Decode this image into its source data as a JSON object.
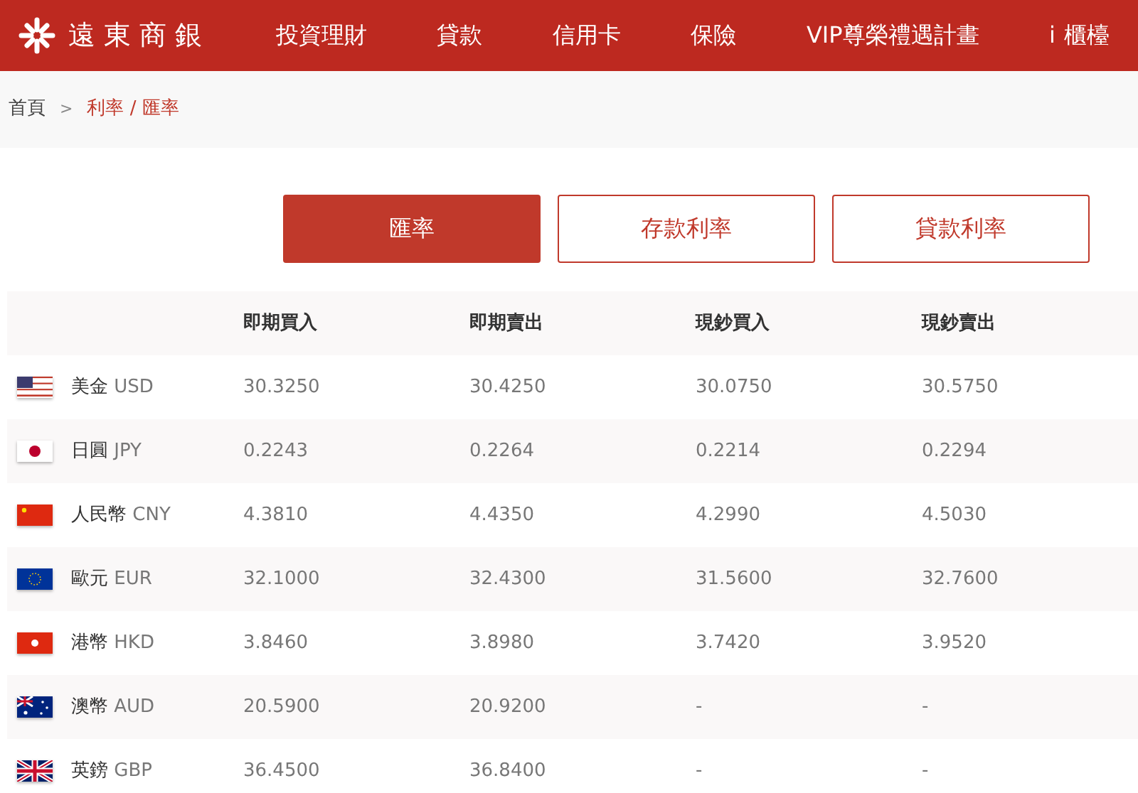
{
  "header": {
    "logo_text": "遠東商銀",
    "nav": [
      "投資理財",
      "貸款",
      "信用卡",
      "保險",
      "VIP尊榮禮遇計畫"
    ],
    "counter_icon": "i",
    "counter_label": "櫃檯"
  },
  "breadcrumb": {
    "home": "首頁",
    "separator": ">",
    "current": "利率 / 匯率"
  },
  "tabs": [
    {
      "label": "匯率",
      "selected": true
    },
    {
      "label": "存款利率",
      "selected": false
    },
    {
      "label": "貸款利率",
      "selected": false
    }
  ],
  "table": {
    "columns": [
      "即期買入",
      "即期賣出",
      "現鈔買入",
      "現鈔賣出"
    ],
    "rows": [
      {
        "kind": "us",
        "name": "美金",
        "code": "USD",
        "cells": [
          "30.3250",
          "30.4250",
          "30.0750",
          "30.5750"
        ]
      },
      {
        "kind": "jp",
        "name": "日圓",
        "code": "JPY",
        "cells": [
          "0.2243",
          "0.2264",
          "0.2214",
          "0.2294"
        ]
      },
      {
        "kind": "cn",
        "name": "人民幣",
        "code": "CNY",
        "cells": [
          "4.3810",
          "4.4350",
          "4.2990",
          "4.5030"
        ]
      },
      {
        "kind": "eu",
        "name": "歐元",
        "code": "EUR",
        "cells": [
          "32.1000",
          "32.4300",
          "31.5600",
          "32.7600"
        ]
      },
      {
        "kind": "hk",
        "name": "港幣",
        "code": "HKD",
        "cells": [
          "3.8460",
          "3.8980",
          "3.7420",
          "3.9520"
        ]
      },
      {
        "kind": "au",
        "name": "澳幣",
        "code": "AUD",
        "cells": [
          "20.5900",
          "20.9200",
          "-",
          "-"
        ]
      },
      {
        "kind": "gb",
        "name": "英鎊",
        "code": "GBP",
        "cells": [
          "36.4500",
          "36.8400",
          "-",
          "-"
        ]
      }
    ]
  }
}
